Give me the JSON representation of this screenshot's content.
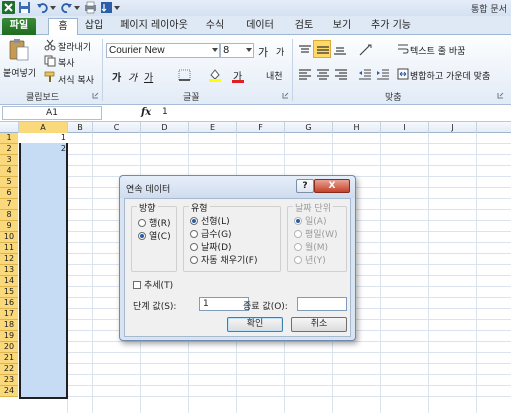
{
  "window": {
    "title": "통합 문서"
  },
  "tabs": [
    {
      "label": "파일"
    },
    {
      "label": "홈"
    },
    {
      "label": "삽입"
    },
    {
      "label": "페이지 레이아웃"
    },
    {
      "label": "수식"
    },
    {
      "label": "데이터"
    },
    {
      "label": "검토"
    },
    {
      "label": "보기"
    },
    {
      "label": "추가 기능"
    }
  ],
  "ribbon": {
    "clipboard": {
      "label": "클립보드",
      "paste": "붙여넣기",
      "cut": "잘라내기",
      "copy": "복사",
      "format_painter": "서식 복사"
    },
    "font": {
      "label": "글꼴",
      "name": "Courier New",
      "size": "8",
      "bold": "가",
      "italic": "가",
      "underline": "가",
      "grow": "가",
      "shrink": "가",
      "color_glyph": "가",
      "phonetic": "내천"
    },
    "alignment": {
      "label": "맞춤",
      "wrap": "텍스트 줄 바꿈",
      "merge": "병합하고 가운데 맞춤"
    }
  },
  "formula_bar": {
    "name_box": "A1",
    "fx": "fx",
    "content": "1"
  },
  "grid": {
    "columns": [
      "A",
      "B",
      "C",
      "D",
      "E",
      "F",
      "G",
      "H",
      "I",
      "J"
    ],
    "rows": [
      "1",
      "2",
      "3",
      "4",
      "5",
      "6",
      "7",
      "8",
      "9",
      "10",
      "11",
      "12",
      "13",
      "14",
      "15",
      "16",
      "17",
      "18",
      "19",
      "20",
      "21",
      "22",
      "23",
      "24"
    ],
    "cells": {
      "A1": "1",
      "A2": "2"
    }
  },
  "dialog": {
    "title": "연속 데이터",
    "help": "?",
    "close": "X",
    "direction": {
      "label": "방향",
      "options": [
        "행(R)",
        "열(C)"
      ],
      "selected": "열(C)"
    },
    "type": {
      "label": "유형",
      "options": [
        "선형(L)",
        "급수(G)",
        "날짜(D)",
        "자동 채우기(F)"
      ],
      "selected": "선형(L)"
    },
    "date_unit": {
      "label": "날짜 단위",
      "options": [
        "일(A)",
        "평일(W)",
        "월(M)",
        "년(Y)"
      ],
      "selected": "일(A)"
    },
    "trend": {
      "label": "추세(T)",
      "checked": false
    },
    "step": {
      "label": "단계 값(S):",
      "value": "1"
    },
    "stop": {
      "label": "종료 값(O):",
      "value": ""
    },
    "ok": "확인",
    "cancel": "취소"
  },
  "colors": {
    "selection": "#c6dcf4",
    "header_highlight": "#f9d97b",
    "file_tab": "#2a7a2a"
  }
}
